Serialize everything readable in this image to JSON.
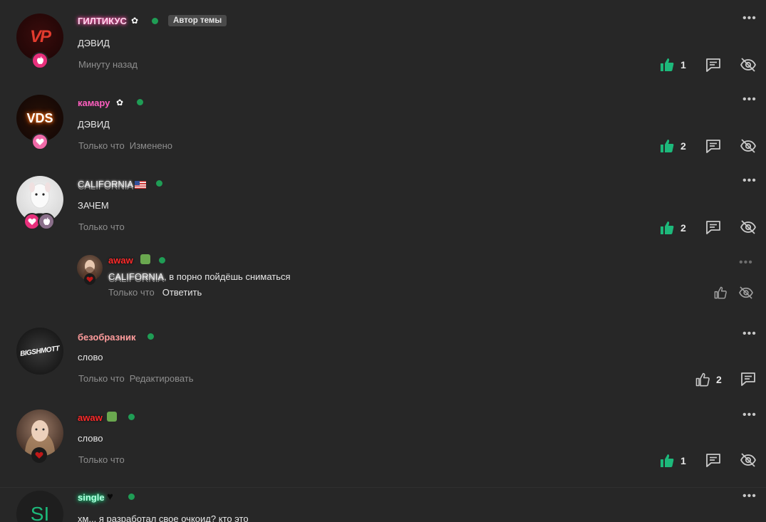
{
  "colors": {
    "background": "#272727",
    "like_active": "#1db97b",
    "online": "#1f9d55"
  },
  "comments": [
    {
      "username": "ГИЛТИКУС",
      "author_tag": "Автор темы",
      "text": "ДЭВИД",
      "time": "Минуту назад",
      "likes": "1",
      "avatar_text": "VP"
    },
    {
      "username": "камару",
      "text": "ДЭВИД",
      "time": "Только что",
      "edited": "Изменено",
      "likes": "2",
      "avatar_text": "VDS"
    },
    {
      "username": "CALIFORNIA",
      "text": "ЗАЧЕМ",
      "time": "Только что",
      "likes": "2"
    },
    {
      "username": "awaw",
      "mention": "CALIFORNIA",
      "text": ", в порно пойдёшь сниматься",
      "time": "Только что",
      "reply_label": "Ответить"
    },
    {
      "username": "безобразник",
      "text": "слово",
      "time": "Только что",
      "edit_label": "Редактировать",
      "likes": "2",
      "avatar_text": "BIGSHMOTT"
    },
    {
      "username": "awaw",
      "text": "слово",
      "time": "Только что",
      "likes": "1"
    },
    {
      "username": "single",
      "text": "хм... я разработал свое очкоид? кто это",
      "avatar_text": "SI"
    }
  ]
}
